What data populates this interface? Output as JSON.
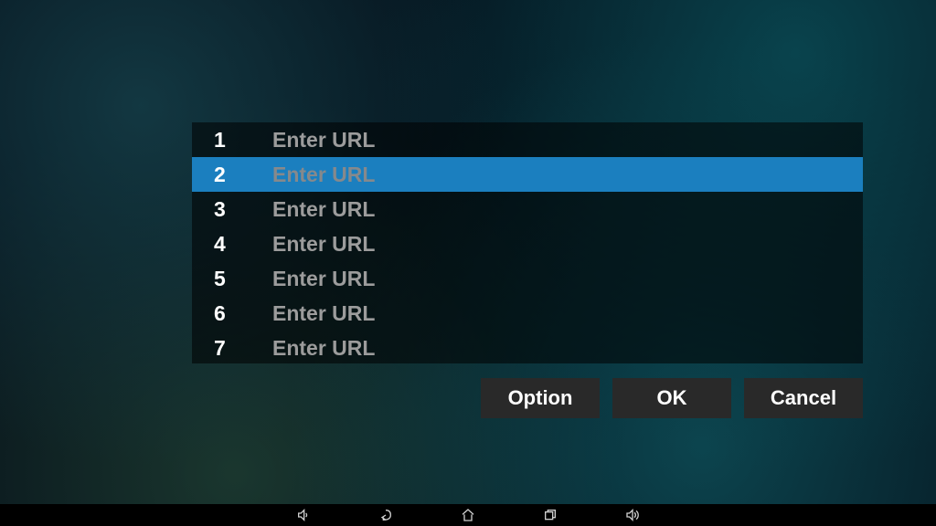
{
  "dialog": {
    "rows": [
      {
        "index": "1",
        "placeholder": "Enter URL",
        "selected": false
      },
      {
        "index": "2",
        "placeholder": "Enter URL",
        "selected": true
      },
      {
        "index": "3",
        "placeholder": "Enter URL",
        "selected": false
      },
      {
        "index": "4",
        "placeholder": "Enter URL",
        "selected": false
      },
      {
        "index": "5",
        "placeholder": "Enter URL",
        "selected": false
      },
      {
        "index": "6",
        "placeholder": "Enter URL",
        "selected": false
      },
      {
        "index": "7",
        "placeholder": "Enter URL",
        "selected": false
      }
    ],
    "buttons": {
      "option": "Option",
      "ok": "OK",
      "cancel": "Cancel"
    }
  },
  "nav": {
    "volume_down": "volume-down-icon",
    "back": "back-icon",
    "home": "home-icon",
    "recent": "recent-icon",
    "volume_up": "volume-up-icon"
  }
}
